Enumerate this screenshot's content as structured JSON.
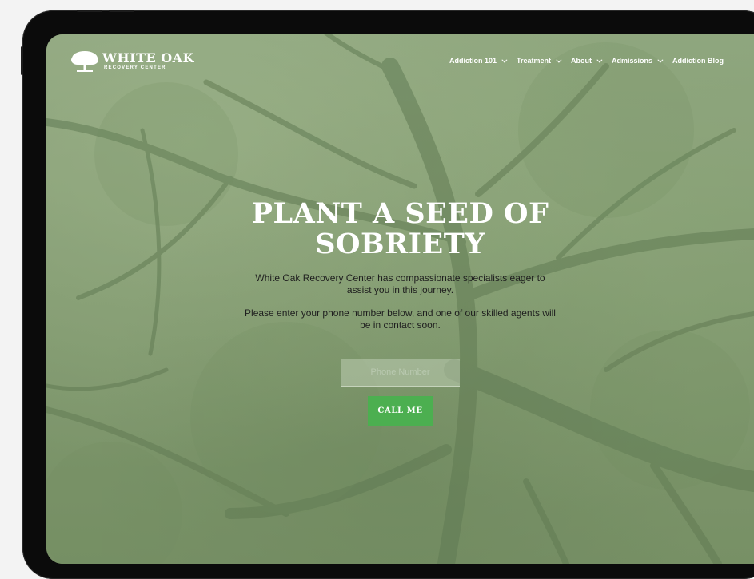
{
  "brand": {
    "name": "WHITE OAK",
    "subtitle": "RECOVERY CENTER",
    "logo_icon": "oak-tree-icon"
  },
  "nav": {
    "items": [
      {
        "label": "Addiction 101",
        "has_dropdown": true
      },
      {
        "label": "Treatment",
        "has_dropdown": true
      },
      {
        "label": "About",
        "has_dropdown": true
      },
      {
        "label": "Admissions",
        "has_dropdown": true
      },
      {
        "label": "Addiction Blog",
        "has_dropdown": false
      }
    ]
  },
  "hero": {
    "title_line1": "PLANT A SEED OF",
    "title_line2": "SOBRIETY",
    "paragraph1": "White Oak Recovery Center has compassionate specialists eager to assist you in this journey.",
    "paragraph2": "Please enter your phone number below, and one of our skilled agents will be in contact soon."
  },
  "form": {
    "phone_placeholder": "Phone Number",
    "phone_value": "",
    "submit_label": "CALL ME"
  },
  "colors": {
    "accent": "#4caf50",
    "background_tint": "#8fa37f",
    "device_frame": "#0b0b0b"
  }
}
